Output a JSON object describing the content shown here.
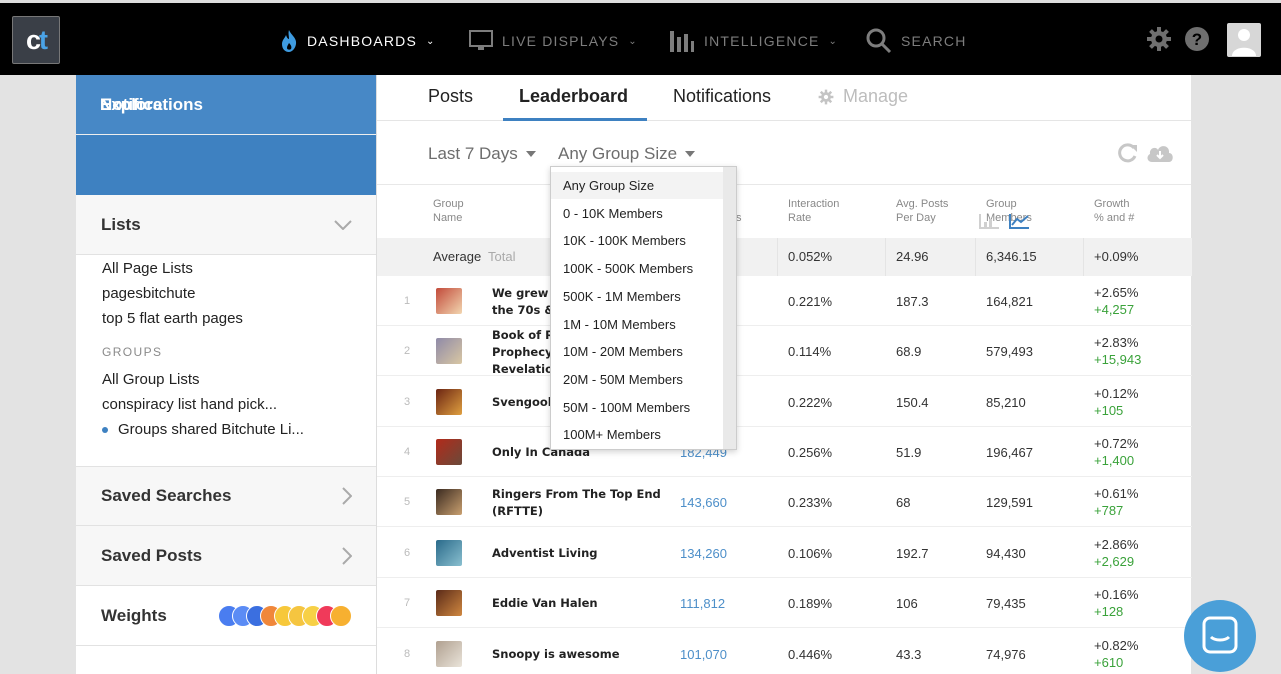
{
  "app": {
    "logo_text_c": "c",
    "logo_text_t": "t"
  },
  "nav": {
    "dashboards": "DASHBOARDS",
    "live_displays": "LIVE DISPLAYS",
    "intelligence": "INTELLIGENCE",
    "search": "SEARCH"
  },
  "sidebar": {
    "notifications": "Notifications",
    "explore": "Explore",
    "lists": "Lists",
    "page_lists": [
      "All Page Lists",
      "pagesbitchute",
      "top 5 flat earth pages"
    ],
    "groups_header": "GROUPS",
    "group_lists": [
      "All Group Lists",
      "conspiracy list hand pick...",
      "Groups shared Bitchute Li..."
    ],
    "saved_searches": "Saved Searches",
    "saved_posts": "Saved Posts",
    "weights": "Weights"
  },
  "tabs": {
    "posts": "Posts",
    "leaderboard": "Leaderboard",
    "notifications": "Notifications",
    "manage": "Manage"
  },
  "filters": {
    "period": "Last 7 Days",
    "group_size": "Any Group Size"
  },
  "table": {
    "headers": {
      "group_name": [
        "Group",
        "Name"
      ],
      "interactions": "s",
      "interaction_rate": [
        "Interaction",
        "Rate"
      ],
      "avg_posts": [
        "Avg. Posts",
        "Per Day"
      ],
      "group_members": [
        "Group",
        "Members"
      ],
      "growth": [
        "Growth",
        "% and #"
      ]
    },
    "average": {
      "label": "Average",
      "total": "Total",
      "rate": "0.052%",
      "posts": "24.96",
      "members": "6,346.15",
      "growth": "+0.09%"
    },
    "rows": [
      {
        "rank": "1",
        "name": "We grew u\nthe 70s &",
        "interactions": "",
        "rate": "0.221%",
        "posts": "187.3",
        "members": "164,821",
        "growth_pct": "+2.65%",
        "growth_num": "+4,257"
      },
      {
        "rank": "2",
        "name": "Book of Re\nProphecy\nRevelation",
        "interactions": "",
        "rate": "0.114%",
        "posts": "68.9",
        "members": "579,493",
        "growth_pct": "+2.83%",
        "growth_num": "+15,943"
      },
      {
        "rank": "3",
        "name": "Svengoolie",
        "interactions": "",
        "rate": "0.222%",
        "posts": "150.4",
        "members": "85,210",
        "growth_pct": "+0.12%",
        "growth_num": "+105"
      },
      {
        "rank": "4",
        "name": "Only In Canada",
        "interactions": "182,449",
        "rate": "0.256%",
        "posts": "51.9",
        "members": "196,467",
        "growth_pct": "+0.72%",
        "growth_num": "+1,400"
      },
      {
        "rank": "5",
        "name": "Ringers From The Top End\n(RFTTE)",
        "interactions": "143,660",
        "rate": "0.233%",
        "posts": "68",
        "members": "129,591",
        "growth_pct": "+0.61%",
        "growth_num": "+787"
      },
      {
        "rank": "6",
        "name": "Adventist Living",
        "interactions": "134,260",
        "rate": "0.106%",
        "posts": "192.7",
        "members": "94,430",
        "growth_pct": "+2.86%",
        "growth_num": "+2,629"
      },
      {
        "rank": "7",
        "name": "Eddie Van Halen",
        "interactions": "111,812",
        "rate": "0.189%",
        "posts": "106",
        "members": "79,435",
        "growth_pct": "+0.16%",
        "growth_num": "+128"
      },
      {
        "rank": "8",
        "name": "Snoopy is awesome",
        "interactions": "101,070",
        "rate": "0.446%",
        "posts": "43.3",
        "members": "74,976",
        "growth_pct": "+0.82%",
        "growth_num": "+610"
      }
    ]
  },
  "dropdown": {
    "options": [
      "Any Group Size",
      "0 - 10K Members",
      "10K - 100K Members",
      "100K - 500K Members",
      "500K - 1M Members",
      "1M - 10M Members",
      "10M - 20M Members",
      "20M - 50M Members",
      "50M - 100M Members",
      "100M+ Members"
    ],
    "selected": "Any Group Size"
  },
  "colors": {
    "accent": "#3e81c1",
    "growth": "#3aa23a",
    "topbar": "#000000"
  }
}
